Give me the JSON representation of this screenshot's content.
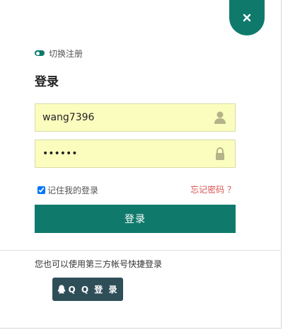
{
  "colors": {
    "accent": "#0f7a6c",
    "input_bg": "#fbfdbf",
    "forgot_link": "#d9534f",
    "qq_button": "#2f4f58"
  },
  "close": {
    "icon": "close-icon"
  },
  "switch": {
    "icon": "toggle-icon",
    "label": "切换注册"
  },
  "form": {
    "title": "登录",
    "username": {
      "value": "wang7396",
      "icon": "user-icon"
    },
    "password": {
      "value": "••••••",
      "icon": "lock-icon"
    },
    "remember": {
      "label": "记住我的登录",
      "checked": true
    },
    "forgot_label": "忘记密码 ？",
    "submit_label": "登录"
  },
  "third_party": {
    "text": "您也可以使用第三方帐号快捷登录",
    "qq_label": "Q Q 登 录",
    "qq_icon": "qq-penguin-icon"
  }
}
